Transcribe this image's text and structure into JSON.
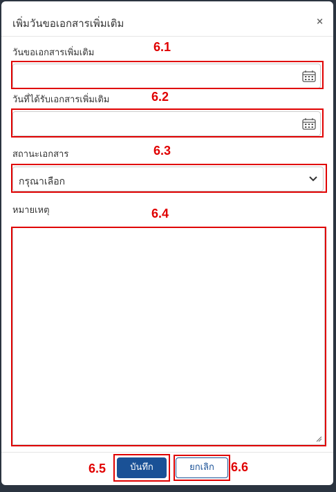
{
  "modal": {
    "title": "เพิ่มวันขอเอกสารเพิ่มเติม",
    "close_symbol": "×"
  },
  "fields": {
    "request_date": {
      "label": "วันขอเอกสารเพิ่มเติม",
      "value": "",
      "icon": "calendar-icon"
    },
    "received_date": {
      "label": "วันที่ได้รับเอกสารเพิ่มเติม",
      "value": "",
      "icon": "calendar-icon"
    },
    "status": {
      "label": "สถานะเอกสาร",
      "selected": "กรุณาเลือก",
      "icon": "chevron-down-icon"
    },
    "remark": {
      "label": "หมายเหตุ",
      "value": ""
    }
  },
  "buttons": {
    "save_label": "บันทึก",
    "cancel_label": "ยกเลิก"
  },
  "annotations": [
    "6.1",
    "6.2",
    "6.3",
    "6.4",
    "6.5",
    "6.6"
  ],
  "colors": {
    "primary": "#1a5196",
    "annotation_red": "#e00000",
    "backdrop": "#2b3440"
  }
}
